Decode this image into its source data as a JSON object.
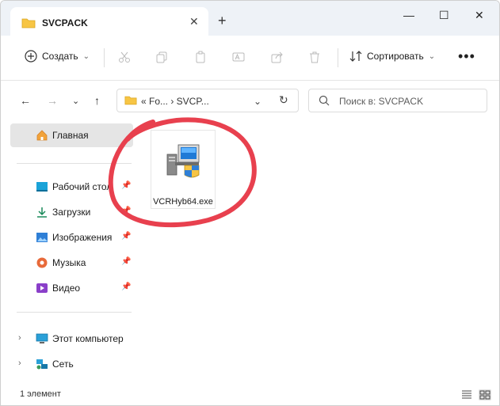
{
  "tab": {
    "title": "SVCPACK",
    "close": "✕",
    "new": "+"
  },
  "window_controls": {
    "minimize": "—",
    "maximize": "☐",
    "close": "✕"
  },
  "toolbar": {
    "create_label": "Создать",
    "sort_label": "Сортировать",
    "more": "•••",
    "dropdown": "⌄"
  },
  "nav": {
    "back": "←",
    "forward": "→",
    "recent": "⌄",
    "up": "↑"
  },
  "address": {
    "path": "«  Fo...  ›  SVCP...",
    "dropdown": "⌄",
    "refresh": "↻"
  },
  "search": {
    "placeholder": "Поиск в: SVCPACK"
  },
  "sidebar": {
    "home": "Главная",
    "quick": [
      {
        "label": "Рабочий стол",
        "icon": "desktop-icon",
        "pinned": true
      },
      {
        "label": "Загрузки",
        "icon": "download-icon",
        "pinned": true
      },
      {
        "label": "Изображения",
        "icon": "images-icon",
        "pinned": true
      },
      {
        "label": "Музыка",
        "icon": "music-icon",
        "pinned": true
      },
      {
        "label": "Видео",
        "icon": "video-icon",
        "pinned": true
      }
    ],
    "this_pc": "Этот компьютер",
    "network": "Сеть",
    "pin_glyph": "📌",
    "chevron": "›"
  },
  "files": [
    {
      "name": "VCRHyb64.exe",
      "icon": "installer-exe-icon"
    }
  ],
  "status": {
    "count": "1 элемент"
  },
  "colors": {
    "accent": "#0067c0",
    "folder": "#f7c544",
    "annotation": "#e8404e"
  }
}
